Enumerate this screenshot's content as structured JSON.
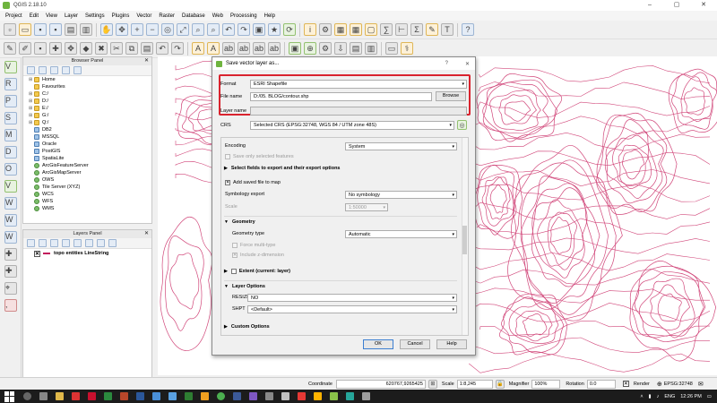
{
  "window": {
    "title": "QGIS 2.18.10",
    "controls": [
      "–",
      "▢",
      "✕"
    ]
  },
  "menubar": {
    "items": [
      "Project",
      "Edit",
      "View",
      "Layer",
      "Settings",
      "Plugins",
      "Vector",
      "Raster",
      "Database",
      "Web",
      "Processing",
      "Help"
    ]
  },
  "browser_panel": {
    "title": "Browser Panel",
    "close": "✕",
    "items": [
      {
        "label": "Home",
        "expander": "⊞",
        "icon": "folder"
      },
      {
        "label": "Favourites",
        "expander": "",
        "icon": "folder"
      },
      {
        "label": "C:/",
        "expander": "⊞",
        "icon": "folder"
      },
      {
        "label": "D:/",
        "expander": "⊞",
        "icon": "folder"
      },
      {
        "label": "E:/",
        "expander": "⊞",
        "icon": "folder"
      },
      {
        "label": "G:/",
        "expander": "⊞",
        "icon": "folder"
      },
      {
        "label": "Q:/",
        "expander": "⊞",
        "icon": "folder"
      },
      {
        "label": "DB2",
        "expander": "",
        "icon": "db"
      },
      {
        "label": "MSSQL",
        "expander": "",
        "icon": "db"
      },
      {
        "label": "Oracle",
        "expander": "",
        "icon": "db"
      },
      {
        "label": "PostGIS",
        "expander": "",
        "icon": "db"
      },
      {
        "label": "SpatiaLite",
        "expander": "",
        "icon": "db"
      },
      {
        "label": "ArcGisFeatureServer",
        "expander": "",
        "icon": "web"
      },
      {
        "label": "ArcGisMapServer",
        "expander": "",
        "icon": "web"
      },
      {
        "label": "OWS",
        "expander": "",
        "icon": "web"
      },
      {
        "label": "Tile Server (XYZ)",
        "expander": "",
        "icon": "web"
      },
      {
        "label": "WCS",
        "expander": "",
        "icon": "web"
      },
      {
        "label": "WFS",
        "expander": "",
        "icon": "web"
      },
      {
        "label": "WMS",
        "expander": "",
        "icon": "web"
      }
    ]
  },
  "layers_panel": {
    "title": "Layers Panel",
    "close": "✕",
    "layers": [
      {
        "name": "topo entities LineString",
        "checked": "✕",
        "color": "#c2185b"
      }
    ]
  },
  "dialog": {
    "title": "Save vector layer as...",
    "help_glyph": "?",
    "close_glyph": "✕",
    "format_label": "Format",
    "format_value": "ESRI Shapefile",
    "filename_label": "File name",
    "filename_value": "D:/05. BLOG/contour.shp",
    "browse_label": "Browse",
    "layername_label": "Layer name",
    "layername_value": "",
    "crs_label": "CRS",
    "crs_value": "Selected CRS (EPSG:32748, WGS 84 / UTM zone 48S)",
    "encoding_label": "Encoding",
    "encoding_value": "System",
    "save_selected_label": "Save only selected features",
    "select_fields_label": "Select fields to export and their export options",
    "add_saved_label": "Add saved file to map",
    "add_saved_checked": "✕",
    "symbology_label": "Symbology export",
    "symbology_value": "No symbology",
    "scale_label": "Scale",
    "scale_value": "1:50000",
    "geometry_section": "Geometry",
    "geometry_type_label": "Geometry type",
    "geometry_type_value": "Automatic",
    "force_multi_label": "Force multi-type",
    "include_z_label": "Include z-dimension",
    "include_z_checked": "✕",
    "extent_label": "Extent (current: layer)",
    "layer_options_section": "Layer Options",
    "resize_label": "RESIZE",
    "resize_value": "NO",
    "shpt_label": "SHPT",
    "shpt_value": "<Default>",
    "custom_options_label": "Custom Options",
    "ok_label": "OK",
    "cancel_label": "Cancel",
    "help_label": "Help",
    "highlight_color": "#d9232e"
  },
  "statusbar": {
    "coordinate_label": "Coordinate",
    "coordinate_value": "620767,9265425",
    "scale_label": "Scale",
    "scale_value": "1:8,245",
    "magnifier_label": "Magnifier",
    "magnifier_value": "100%",
    "rotation_label": "Rotation",
    "rotation_value": "0.0",
    "render_label": "Render",
    "render_checked": "✕",
    "crs_value": "EPSG:32748"
  },
  "taskbar": {
    "language": "ENG",
    "time": "12:26 PM"
  },
  "map": {
    "contour_color": "#d1477a"
  }
}
